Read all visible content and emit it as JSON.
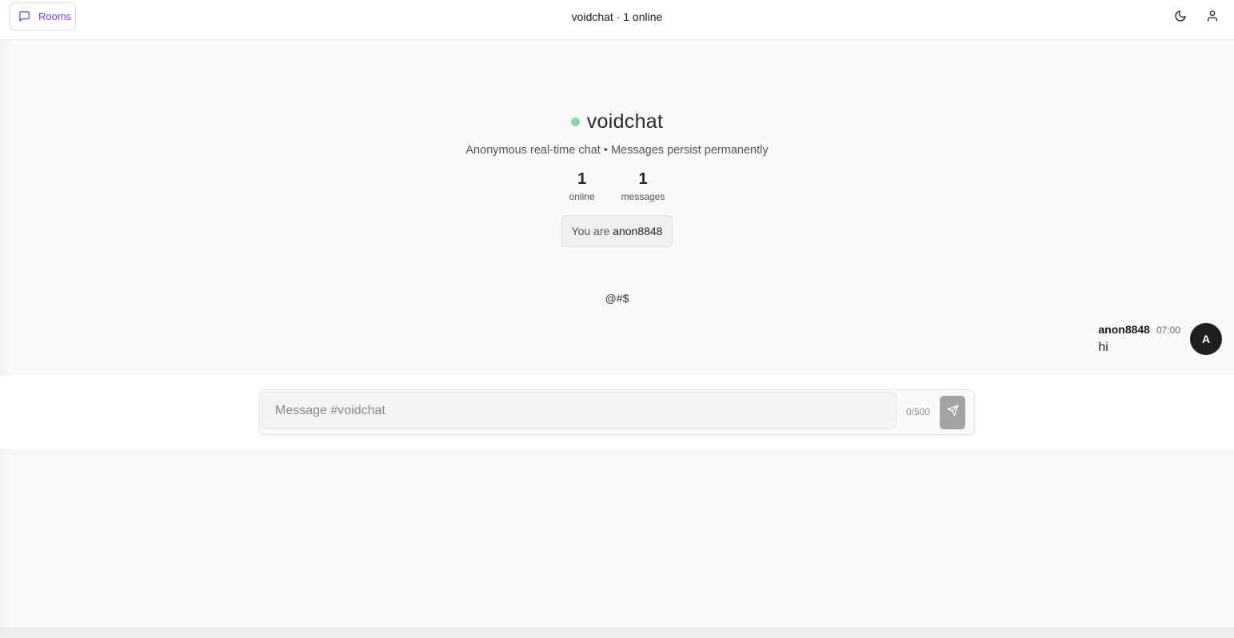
{
  "header": {
    "rooms_label": "Rooms",
    "title": "voidchat · 1 online",
    "icons": {
      "rooms": "message-square-icon",
      "theme": "moon-icon",
      "account": "user-icon"
    }
  },
  "hero": {
    "room_name": "voidchat",
    "subtitle": "Anonymous real-time chat • Messages persist permanently",
    "stats": [
      {
        "value": "1",
        "label": "online"
      },
      {
        "value": "1",
        "label": "messages"
      }
    ],
    "identity_prefix": "You are",
    "identity_name": "anon8848"
  },
  "symbol_line": "@#$",
  "messages": [
    {
      "user": "anon8848",
      "time": "07:00",
      "text": "hi",
      "avatar_letter": "A"
    }
  ],
  "composer": {
    "placeholder": "Message #voidchat",
    "value": "",
    "char_count": "0/500"
  },
  "colors": {
    "accent": "#7c3aed",
    "online_dot": "#86d9a5",
    "avatar_bg": "#1f1f1f",
    "send_button": "#a3a3a3"
  }
}
